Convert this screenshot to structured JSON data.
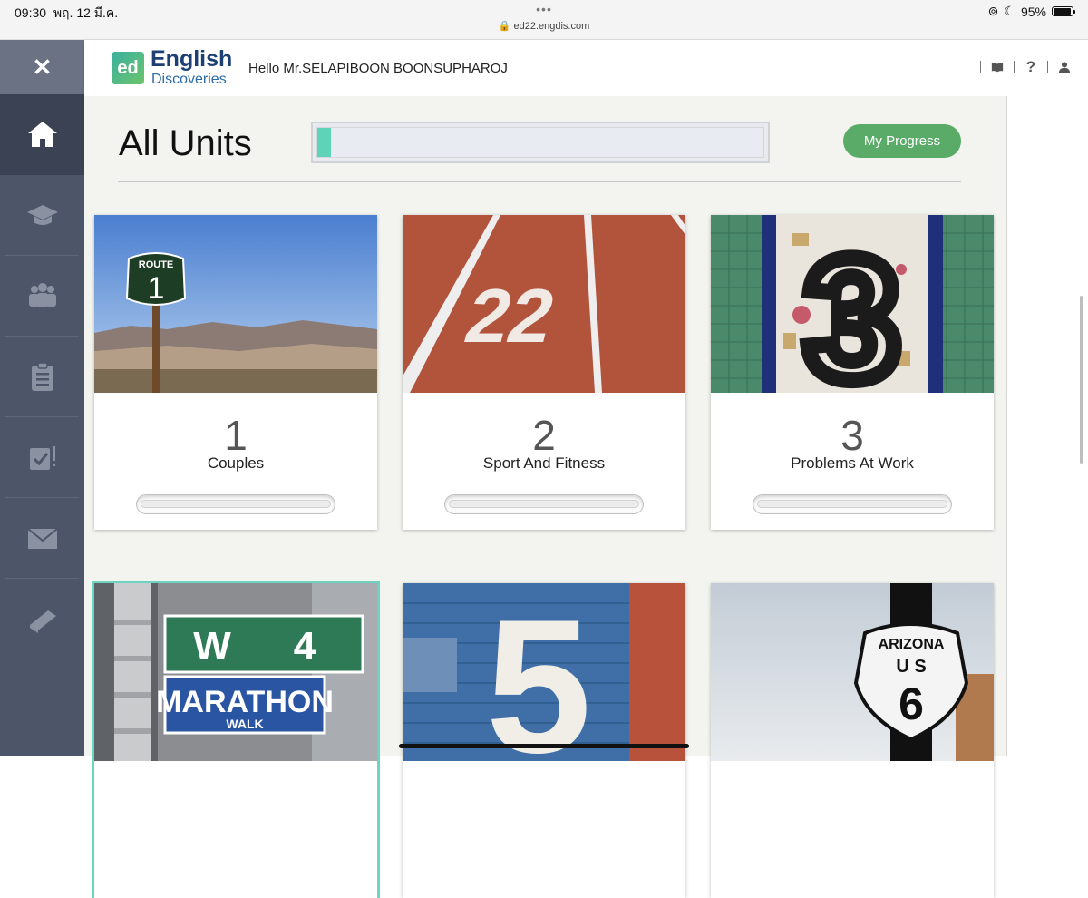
{
  "status_bar": {
    "time": "09:30",
    "date": "พฤ. 12 มี.ค.",
    "url": "ed22.engdis.com",
    "battery": "95%",
    "battery_level": 0.95
  },
  "sidebar": {
    "close_icon": "close-icon",
    "items": [
      {
        "icon": "home-icon",
        "active": true
      },
      {
        "icon": "graduation-cap-icon",
        "active": false
      },
      {
        "icon": "group-icon",
        "active": false
      },
      {
        "icon": "clipboard-icon",
        "active": false
      },
      {
        "icon": "assignment-check-icon",
        "active": false
      },
      {
        "icon": "envelope-icon",
        "active": false
      },
      {
        "icon": "book-icon",
        "active": false
      }
    ]
  },
  "header": {
    "logo_badge": "ed",
    "logo_line1": "English",
    "logo_line2": "Discoveries",
    "greeting": "Hello Mr.SELAPIBOON BOONSUPHAROJ",
    "help_label": "?"
  },
  "main": {
    "title": "All Units",
    "overall_progress": 0.03,
    "my_progress_label": "My Progress",
    "accent_color": "#5aab68"
  },
  "units": [
    {
      "number": "1",
      "name": "Couples",
      "image": "route-1-sign",
      "progress": 0.0
    },
    {
      "number": "2",
      "name": "Sport And Fitness",
      "image": "running-track-22",
      "progress": 0.0
    },
    {
      "number": "3",
      "name": "Problems At Work",
      "image": "mosaic-number-3",
      "progress": 0.0
    },
    {
      "number": "",
      "name": "",
      "image": "w4-marathon-walk-sign",
      "progress": 0.0
    },
    {
      "number": "",
      "name": "",
      "image": "painted-number-5",
      "progress": 0.0
    },
    {
      "number": "",
      "name": "",
      "image": "arizona-us-6-sign",
      "progress": 0.0
    }
  ],
  "sign_text": {
    "route": "ROUTE",
    "route_num": "1",
    "track_num": "22",
    "street_w": "W",
    "street_num": "4",
    "marathon": "MARATHON",
    "walk": "WALK",
    "arizona": "ARIZONA",
    "us": "U S",
    "us_num": "6",
    "five": "5"
  }
}
